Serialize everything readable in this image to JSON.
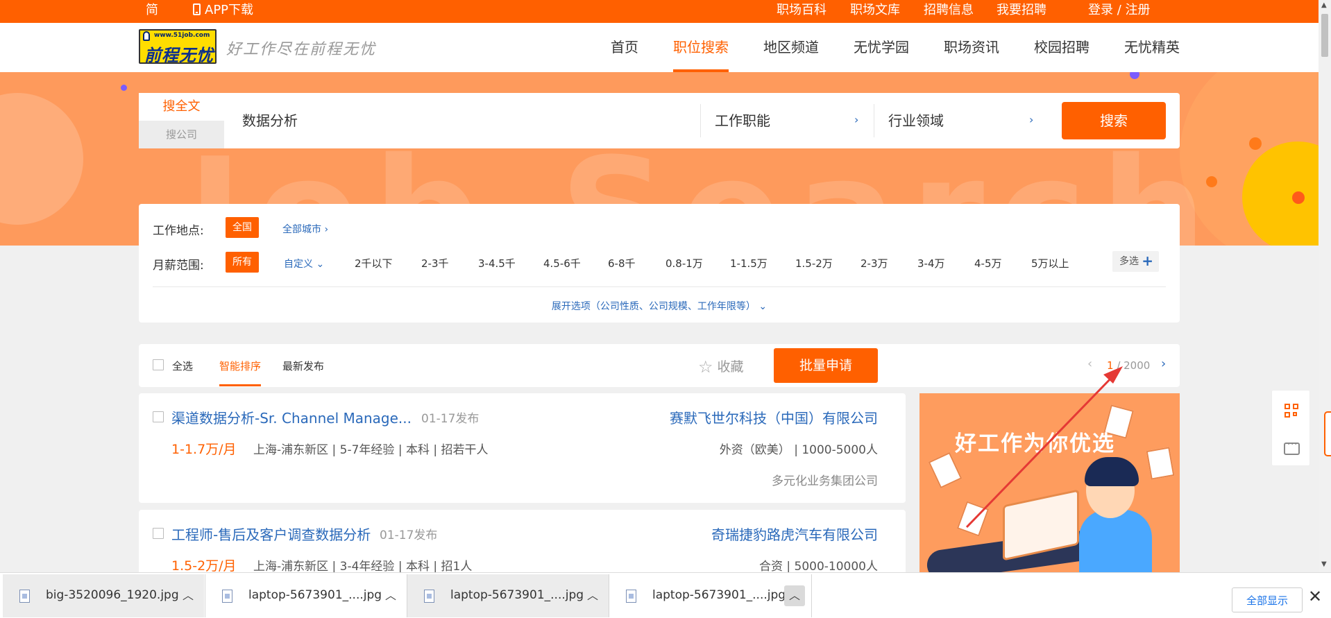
{
  "topbar": {
    "lang": "简",
    "app_download": "APP下载",
    "links": [
      "职场百科",
      "职场文库",
      "招聘信息",
      "我要招聘"
    ],
    "login": "登录 / 注册"
  },
  "header": {
    "logo_url": "www.51job.com",
    "logo_name": "前程无忧",
    "slogan": "好工作尽在前程无忧",
    "nav": [
      "首页",
      "职位搜索",
      "地区频道",
      "无忧学园",
      "职场资讯",
      "校园招聘",
      "无忧精英"
    ],
    "active_nav": "职位搜索"
  },
  "banner": {
    "bg_text": "Job Search"
  },
  "search": {
    "tab_full": "搜全文",
    "tab_company": "搜公司",
    "keyword": "数据分析",
    "function": "工作职能",
    "industry": "行业领域",
    "button": "搜索"
  },
  "filters": {
    "location_label": "工作地点:",
    "location_selected": "全国",
    "all_cities": "全部城市",
    "salary_label": "月薪范围:",
    "salary_selected": "所有",
    "custom": "自定义",
    "salary_options": [
      "2千以下",
      "2-3千",
      "3-4.5千",
      "4.5-6千",
      "6-8千",
      "0.8-1万",
      "1-1.5万",
      "1.5-2万",
      "2-3万",
      "3-4万",
      "4-5万",
      "5万以上"
    ],
    "multi": "多选",
    "expand": "展开选项（公司性质、公司规模、工作年限等）"
  },
  "toolbar": {
    "select_all": "全选",
    "sort_smart": "智能排序",
    "sort_latest": "最新发布",
    "favorite": "收藏",
    "batch_apply": "批量申请",
    "page_current": "1",
    "page_total": " / 2000"
  },
  "jobs": [
    {
      "title": "渠道数据分析-Sr. Channel Manage...",
      "date": "01-17发布",
      "salary": "1-1.7万/月",
      "meta": "上海-浦东新区 | 5-7年经验 | 本科 | 招若干人",
      "company": "赛默飞世尔科技（中国）有限公司",
      "company_meta": "外资（欧美） | 1000-5000人",
      "industry": "多元化业务集团公司"
    },
    {
      "title": "工程师-售后及客户调查数据分析",
      "date": "01-17发布",
      "salary": "1.5-2万/月",
      "meta": "上海-浦东新区 | 3-4年经验 | 本科 | 招1人",
      "company": "奇瑞捷豹路虎汽车有限公司",
      "company_meta": "合资 | 5000-10000人"
    }
  ],
  "ad": {
    "text": "好工作为你优选"
  },
  "downloads": {
    "items": [
      "big-3520096_1920.jpg",
      "laptop-5673901_....jpg",
      "laptop-5673901_....jpg",
      "laptop-5673901_....jpg"
    ],
    "show_all": "全部显示"
  },
  "colors": {
    "accent": "#ff6000",
    "link": "#2a69ba",
    "banner": "#fe9a5c",
    "annotation": "#e53935"
  }
}
